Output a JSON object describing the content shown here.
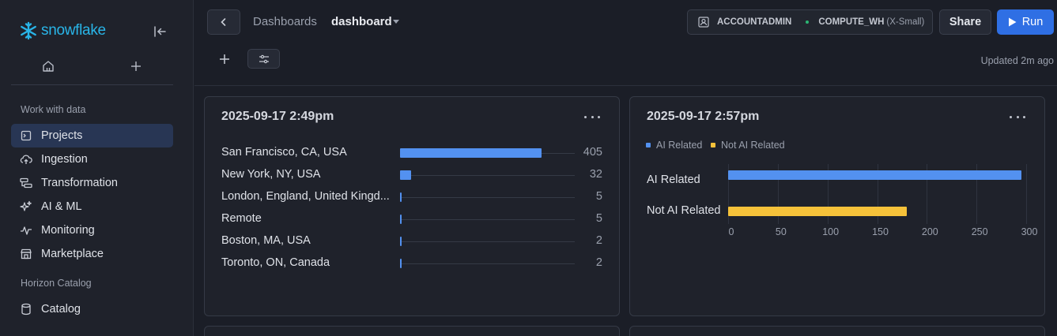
{
  "sidebar": {
    "logo_text": "snowflake",
    "section_work": "Work with data",
    "section_horizon": "Horizon Catalog",
    "items": [
      {
        "label": "Projects",
        "icon": "projects-icon",
        "active": true
      },
      {
        "label": "Ingestion",
        "icon": "cloud-upload-icon"
      },
      {
        "label": "Transformation",
        "icon": "transformation-icon"
      },
      {
        "label": "AI & ML",
        "icon": "sparkle-icon"
      },
      {
        "label": "Monitoring",
        "icon": "activity-icon"
      },
      {
        "label": "Marketplace",
        "icon": "store-icon"
      },
      {
        "label": "Catalog",
        "icon": "database-icon"
      }
    ]
  },
  "header": {
    "breadcrumb_parent": "Dashboards",
    "breadcrumb_current": "dashboard",
    "role": "ACCOUNTADMIN",
    "warehouse": "COMPUTE_WH",
    "warehouse_size": "(X-Small)",
    "share_label": "Share",
    "run_label": "Run",
    "updated": "Updated 2m ago"
  },
  "colors": {
    "accent": "#2f6fe4",
    "bar_blue": "#5391f0",
    "bar_yellow": "#f6c23a",
    "brand": "#29b5e8"
  },
  "tiles": [
    {
      "title": "2025-09-17 2:49pm",
      "chart_data": {
        "type": "bar",
        "orientation": "horizontal",
        "categories": [
          "San Francisco, CA, USA",
          "New York, NY, USA",
          "London, England, United Kingd...",
          "Remote",
          "Boston, MA, USA",
          "Toronto, ON, Canada"
        ],
        "values": [
          405,
          32,
          5,
          5,
          2,
          2
        ],
        "value_labels": [
          "405",
          "32",
          "5",
          "5",
          "2",
          "2"
        ],
        "xlim": [
          0,
          500
        ]
      }
    },
    {
      "title": "2025-09-17 2:57pm",
      "chart_data": {
        "type": "bar",
        "orientation": "horizontal",
        "categories": [
          "AI Related",
          "Not AI Related"
        ],
        "series": [
          {
            "name": "AI Related",
            "values": [
              295,
              null
            ],
            "color": "#5391f0"
          },
          {
            "name": "Not AI Related",
            "values": [
              null,
              180
            ],
            "color": "#f6c23a"
          }
        ],
        "legend": [
          "AI Related",
          "Not AI Related"
        ],
        "legend_position": "top-left",
        "xticks": [
          "0",
          "50",
          "100",
          "150",
          "200",
          "250",
          "300"
        ],
        "xlim": [
          0,
          300
        ],
        "grid": true
      }
    }
  ]
}
